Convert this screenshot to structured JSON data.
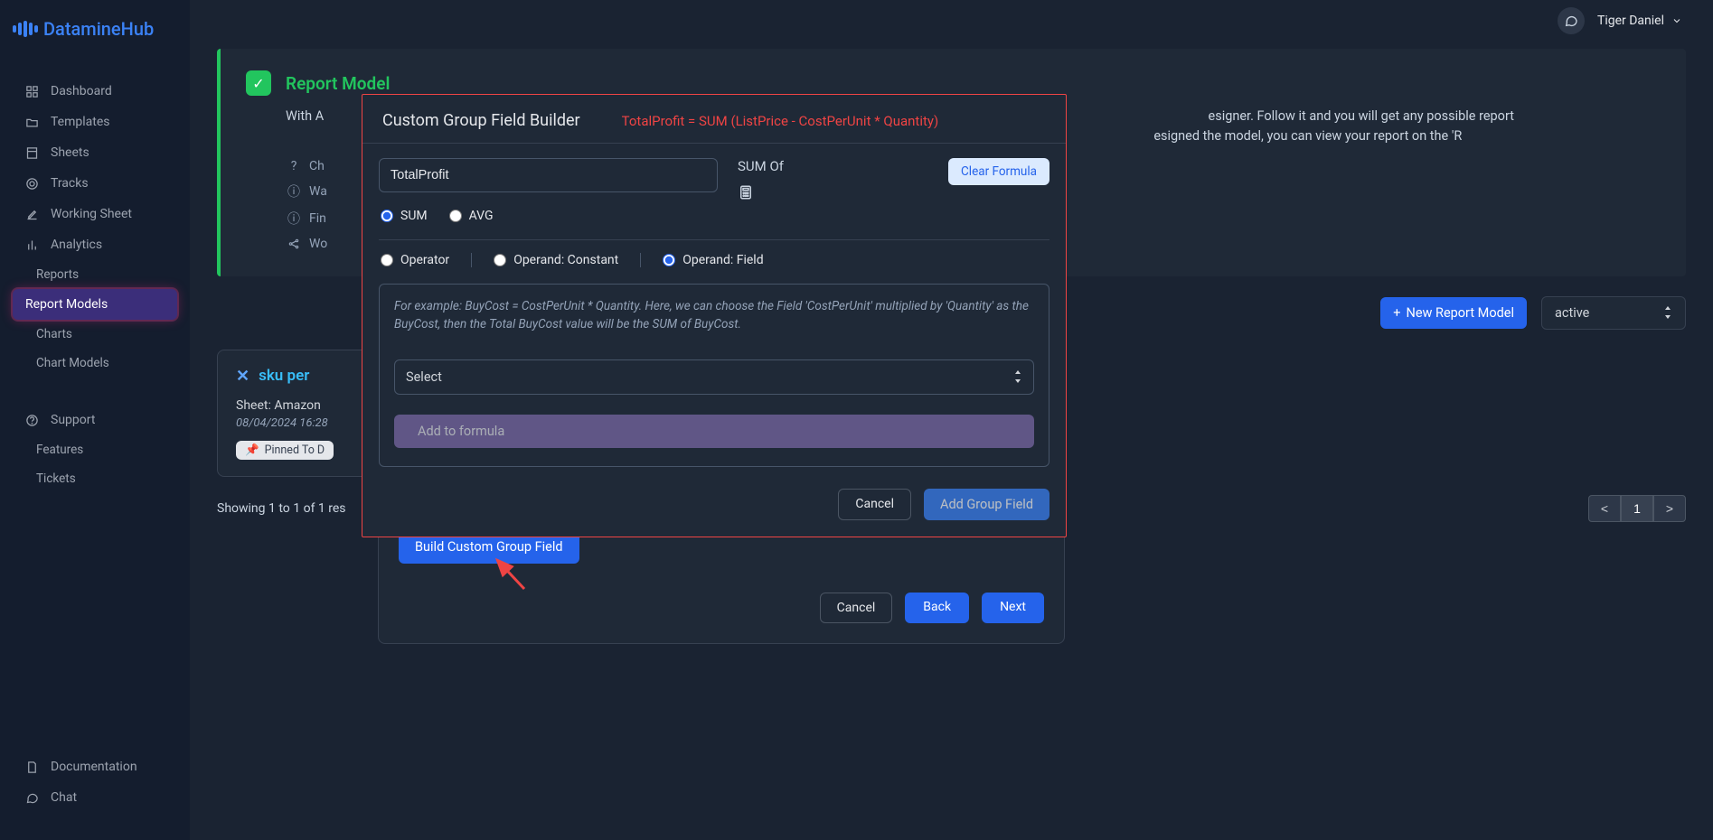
{
  "brand": "DatamineHub",
  "user": "Tiger Daniel",
  "sidebar": {
    "items": [
      {
        "icon": "grid-icon",
        "label": "Dashboard"
      },
      {
        "icon": "folder-icon",
        "label": "Templates"
      },
      {
        "icon": "sheet-icon",
        "label": "Sheets"
      },
      {
        "icon": "target-icon",
        "label": "Tracks"
      },
      {
        "icon": "edit-icon",
        "label": "Working Sheet"
      },
      {
        "icon": "bars-icon",
        "label": "Analytics"
      }
    ],
    "analytics_children": [
      {
        "label": "Reports"
      },
      {
        "label": "Report Models"
      },
      {
        "label": "Charts"
      },
      {
        "label": "Chart Models"
      }
    ],
    "support_label": "Support",
    "support_children": [
      {
        "label": "Features"
      },
      {
        "label": "Tickets"
      }
    ],
    "bottom": [
      {
        "icon": "doc-icon",
        "label": "Documentation"
      },
      {
        "icon": "chat-icon",
        "label": "Chat"
      }
    ]
  },
  "hero": {
    "title": "Report Model",
    "body_prefix": "With A",
    "body_suffix": "esigner. Follow it and you will get any possible report",
    "body_suffix2": "esigned the model, you can view your report on the 'R",
    "rows": [
      {
        "text": "Ch"
      },
      {
        "text": "Wa"
      },
      {
        "text": "Fin"
      },
      {
        "text": "Wo"
      }
    ]
  },
  "actions": {
    "new_label": "New Report Model",
    "status_value": "active"
  },
  "card": {
    "title": "sku per",
    "sheet_prefix": "Sheet: Amazon",
    "date": "08/04/2024 16:28",
    "pin": "Pinned To D"
  },
  "results": "Showing 1 to 1 of 1 res",
  "pager": {
    "prev": "<",
    "page": "1",
    "next": ">"
  },
  "under_modal": {
    "build_btn": "Build Custom Group Field",
    "cancel": "Cancel",
    "back": "Back",
    "next": "Next"
  },
  "modal": {
    "title": "Custom Group Field Builder",
    "formula": "TotalProfit = SUM (ListPrice - CostPerUnit * Quantity)",
    "name_value": "TotalProfit",
    "sum_of": "SUM Of",
    "clear": "Clear Formula",
    "agg_options": {
      "sum": "SUM",
      "avg": "AVG"
    },
    "type_options": {
      "operator": "Operator",
      "constant": "Operand: Constant",
      "field": "Operand: Field"
    },
    "example": "For example: BuyCost = CostPerUnit * Quantity. Here, we can choose the Field 'CostPerUnit' multiplied by 'Quantity' as the BuyCost, then the Total BuyCost value will be the SUM of BuyCost.",
    "select_placeholder": "Select",
    "add_formula": "Add to formula",
    "cancel": "Cancel",
    "add_group": "Add Group Field"
  }
}
